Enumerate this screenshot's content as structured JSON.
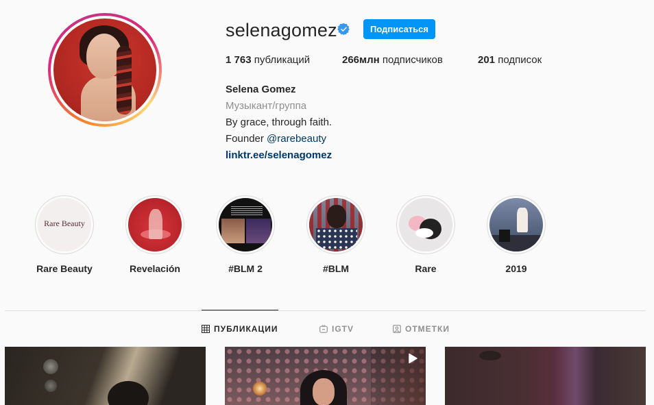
{
  "profile": {
    "username": "selenagomez",
    "follow_label": "Подписаться",
    "stats": {
      "posts_value": "1 763",
      "posts_label": "публикаций",
      "followers_value": "266млн",
      "followers_label": "подписчиков",
      "following_value": "201",
      "following_label": "подписок"
    },
    "bio": {
      "name": "Selena Gomez",
      "category": "Музыкант/группа",
      "line1": "By grace, through faith.",
      "founder_prefix": "Founder ",
      "founder_handle": "@rarebeauty",
      "link": "linktr.ee/selenagomez"
    }
  },
  "highlights": [
    {
      "label": "Rare Beauty",
      "cover_text": "Rare Beauty"
    },
    {
      "label": "Revelación"
    },
    {
      "label": "#BLM 2"
    },
    {
      "label": "#BLM"
    },
    {
      "label": "Rare"
    },
    {
      "label": "2019"
    }
  ],
  "tabs": [
    {
      "label": "ПУБЛИКАЦИИ",
      "icon": "grid-icon",
      "active": true
    },
    {
      "label": "IGTV",
      "icon": "igtv-icon",
      "active": false
    },
    {
      "label": "ОТМЕТКИ",
      "icon": "tagged-icon",
      "active": false
    }
  ],
  "colors": {
    "accent": "#0095f6",
    "verified": "#3897f0",
    "link": "#00376b",
    "secondary_text": "#8e8e8e"
  }
}
